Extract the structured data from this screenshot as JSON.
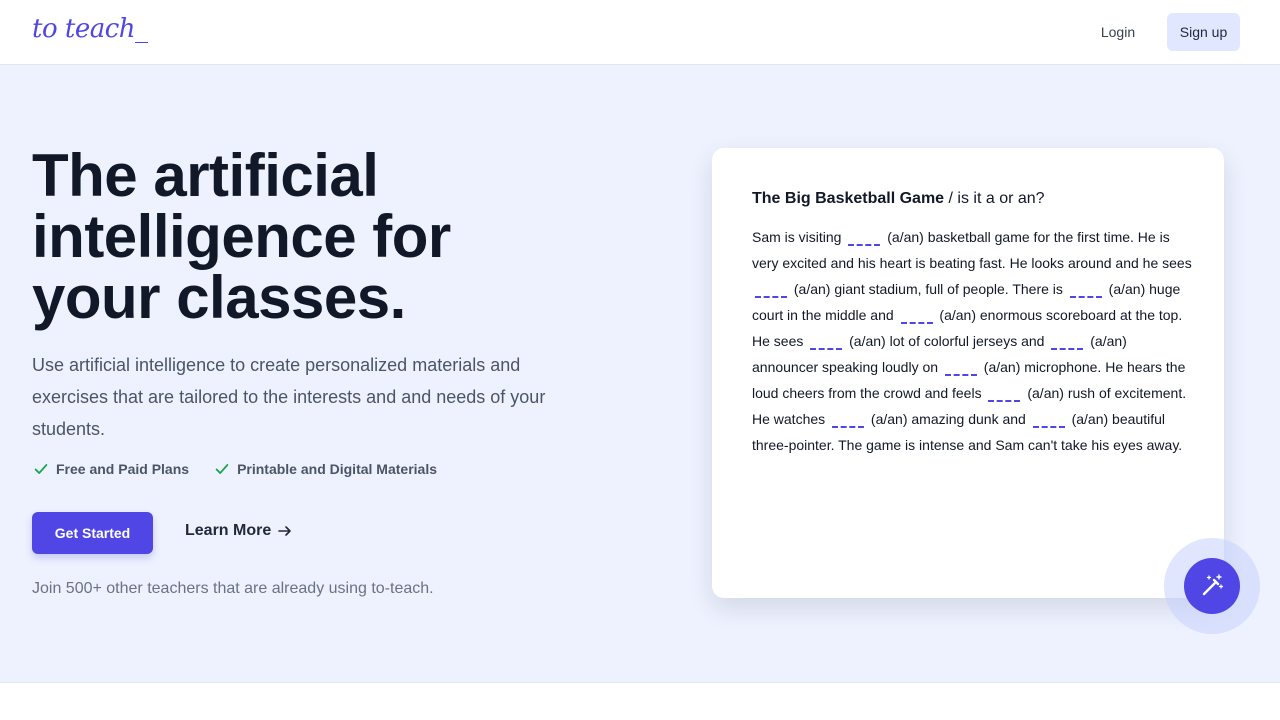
{
  "header": {
    "logo": "to teach_",
    "login_label": "Login",
    "signup_label": "Sign up"
  },
  "hero": {
    "headline_line1": "The artificial",
    "headline_line2": "intelligence for",
    "headline_line3": "your classes.",
    "subtext": "Use artificial intelligence to create personalized materials and exercises that are tailored to the interests and and needs of your students.",
    "features": [
      {
        "label": "Free and Paid Plans",
        "icon": "check-icon"
      },
      {
        "label": "Printable and Digital Materials",
        "icon": "check-icon"
      }
    ],
    "cta_label": "Get Started",
    "learn_more_label": "Learn More",
    "join_text": "Join 500+ other teachers that are already using to-teach."
  },
  "card": {
    "title_bold": "The Big Basketball Game",
    "title_rest": " / is it a or an?",
    "story_segments": [
      "Sam is visiting ",
      " (a/an) basketball game for the first time. He is very excited and his heart is beating fast. He looks around and he sees ",
      " (a/an) giant stadium, full of people. There is ",
      " (a/an) huge court in the middle and ",
      " (a/an) enormous scoreboard at the top. He sees ",
      " (a/an) lot of colorful jerseys and ",
      " (a/an) announcer speaking loudly on ",
      " (a/an) microphone. He hears the loud cheers from the crowd and feels ",
      " (a/an) rush of excitement. He watches ",
      " (a/an) amazing dunk and ",
      " (a/an) beautiful three-pointer. The game is intense and Sam can't take his eyes away."
    ]
  },
  "magic_button": {
    "icon": "magic-wand-icon"
  },
  "colors": {
    "accent": "#4f46e5",
    "hero_bg": "#eef2ff",
    "check": "#16a34a",
    "signup_bg": "#e0e7ff"
  }
}
